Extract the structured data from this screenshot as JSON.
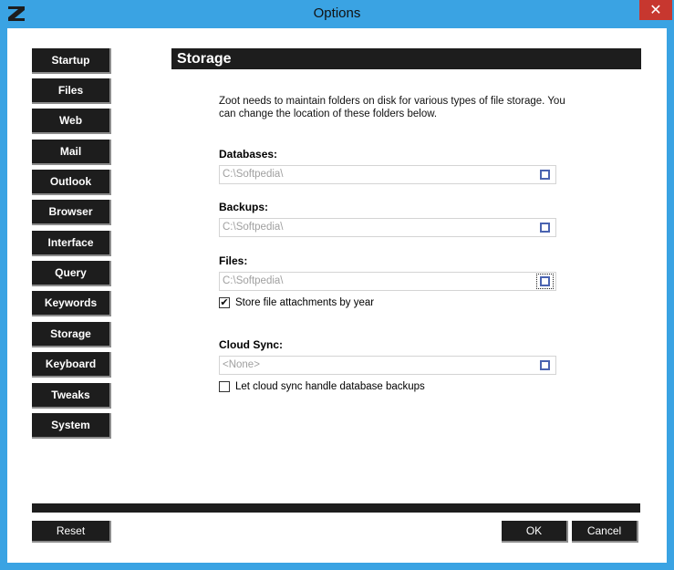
{
  "window": {
    "title": "Options",
    "close_glyph": "✕",
    "accent": "#3aa3e3",
    "app_icon": "zoot-logo-icon"
  },
  "sidebar": {
    "items": [
      {
        "label": "Startup"
      },
      {
        "label": "Files"
      },
      {
        "label": "Web"
      },
      {
        "label": "Mail"
      },
      {
        "label": "Outlook"
      },
      {
        "label": "Browser"
      },
      {
        "label": "Interface"
      },
      {
        "label": "Query"
      },
      {
        "label": "Keywords"
      },
      {
        "label": "Storage"
      },
      {
        "label": "Keyboard"
      },
      {
        "label": "Tweaks"
      },
      {
        "label": "System"
      }
    ]
  },
  "storage": {
    "header": "Storage",
    "description": "Zoot needs to maintain folders on disk for various types of file storage.  You can change the location of these folders below.",
    "databases": {
      "label": "Databases:",
      "value": "C:\\Softpedia\\"
    },
    "backups": {
      "label": "Backups:",
      "value": "C:\\Softpedia\\"
    },
    "files": {
      "label": "Files:",
      "value": "C:\\Softpedia\\"
    },
    "store_by_year": {
      "label": "Store file attachments by year",
      "checked": true,
      "check_glyph": "✔"
    },
    "cloud_sync": {
      "label": "Cloud Sync:",
      "value": "<None>"
    },
    "cloud_backups": {
      "label": "Let cloud sync handle database backups",
      "checked": false
    }
  },
  "footer": {
    "reset_label": "Reset",
    "ok_label": "OK",
    "cancel_label": "Cancel"
  }
}
